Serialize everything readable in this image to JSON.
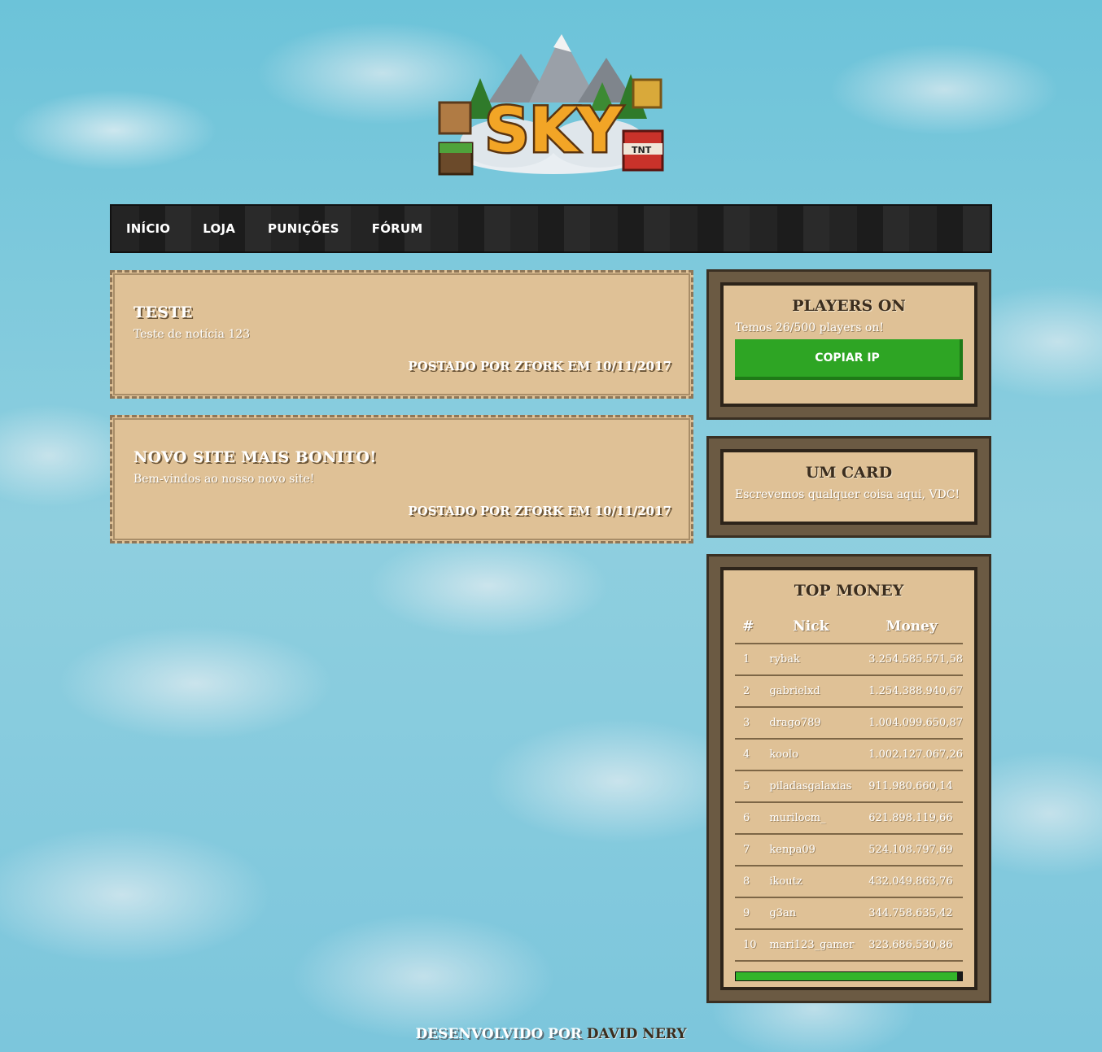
{
  "logo": {
    "text": "SKY",
    "tnt": "TNT"
  },
  "nav": {
    "items": [
      {
        "label": "INÍCIO"
      },
      {
        "label": "LOJA"
      },
      {
        "label": "PUNIÇÕES"
      },
      {
        "label": "FÓRUM"
      }
    ]
  },
  "news": [
    {
      "title": "TESTE",
      "body": "Teste de notícia 123",
      "footer": "POSTADO POR ZFORK EM 10/11/2017"
    },
    {
      "title": "NOVO SITE MAIS BONITO!",
      "body": "Bem-vindos ao nosso novo site!",
      "footer": "POSTADO POR ZFORK EM 10/11/2017"
    }
  ],
  "players_card": {
    "title": "PLAYERS ON",
    "text": "Temos 26/500 players on!",
    "button_label": "COPIAR IP"
  },
  "um_card": {
    "title": "UM CARD",
    "text": "Escrevemos qualquer coisa aqui, VDC!"
  },
  "top_money": {
    "title": "TOP MONEY",
    "headers": [
      "#",
      "Nick",
      "Money"
    ],
    "rows": [
      {
        "pos": "1",
        "nick": "rybak",
        "money": "3.254.585.571,58"
      },
      {
        "pos": "2",
        "nick": "gabrielxd",
        "money": "1.254.388.940,67"
      },
      {
        "pos": "3",
        "nick": "drago789",
        "money": "1.004.099.650,87"
      },
      {
        "pos": "4",
        "nick": "koolo",
        "money": "1.002.127.067,26"
      },
      {
        "pos": "5",
        "nick": "piladasgalaxias",
        "money": "911.980.660,14"
      },
      {
        "pos": "6",
        "nick": "murilocm_",
        "money": "621.898.119,66"
      },
      {
        "pos": "7",
        "nick": "kenpa09",
        "money": "524.108.797,69"
      },
      {
        "pos": "8",
        "nick": "ikoutz",
        "money": "432.049.863,76"
      },
      {
        "pos": "9",
        "nick": "g3an",
        "money": "344.758.635,42"
      },
      {
        "pos": "10",
        "nick": "mari123_gamer",
        "money": "323.686.530,86"
      }
    ],
    "progress_fraction": 0.98
  },
  "footer": {
    "prefix": "DESENVOLVIDO POR ",
    "author": "DAVID NERY"
  },
  "colors": {
    "card_bg": "#dfc196",
    "frame": "#6b5a43",
    "button": "#2ea524",
    "nav_bg": "#222222",
    "sky": "#6cc3d9"
  }
}
